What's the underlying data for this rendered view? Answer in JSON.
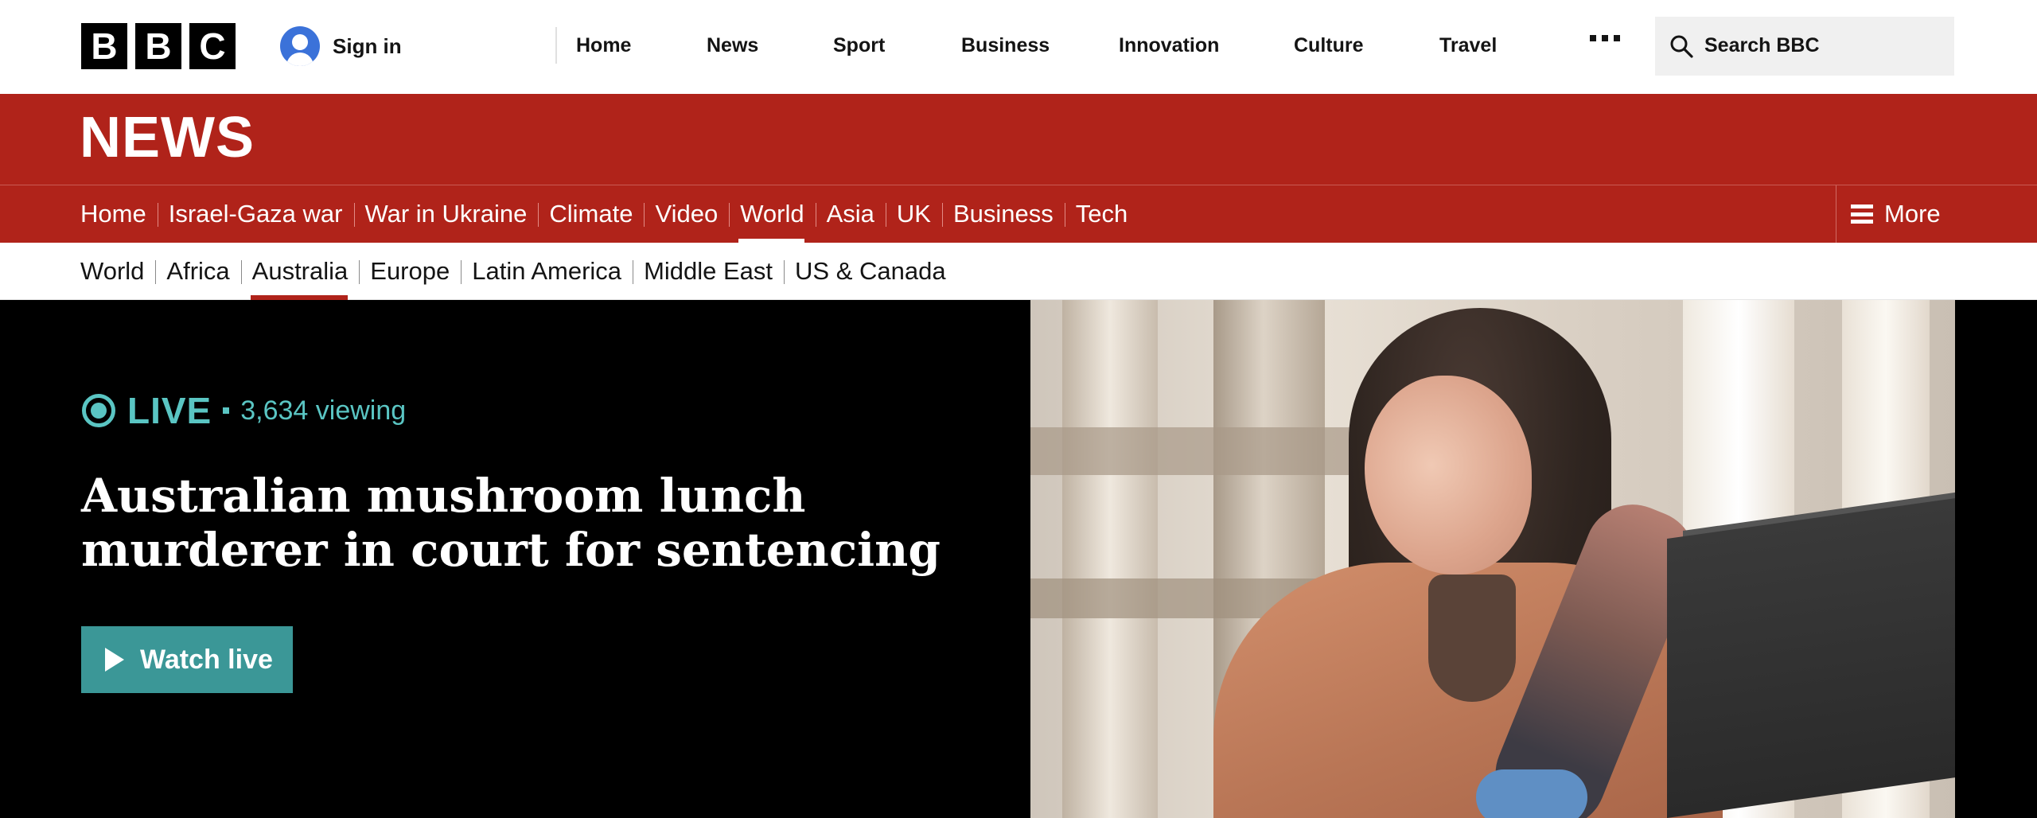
{
  "brand": {
    "logo_letters": [
      "B",
      "B",
      "C"
    ],
    "section_title": "NEWS",
    "colors": {
      "news_red": "#b0231a",
      "live_teal": "#5ac5c3",
      "watch_button": "#3b9797",
      "signin_blue": "#3b72d9"
    }
  },
  "header": {
    "signin_label": "Sign in",
    "signin_icon": "user-avatar-icon",
    "global_nav": [
      "Home",
      "News",
      "Sport",
      "Business",
      "Innovation",
      "Culture",
      "Travel"
    ],
    "more_icon": "more-dots-icon",
    "search_placeholder": "Search BBC",
    "search_icon": "search-icon"
  },
  "section_nav": {
    "items": [
      "Home",
      "Israel-Gaza war",
      "War in Ukraine",
      "Climate",
      "Video",
      "World",
      "Asia",
      "UK",
      "Business",
      "Tech"
    ],
    "active": "World",
    "more_label": "More",
    "more_icon": "hamburger-menu-icon"
  },
  "sub_nav": {
    "items": [
      "World",
      "Africa",
      "Australia",
      "Europe",
      "Latin America",
      "Middle East",
      "US & Canada"
    ],
    "active": "Australia"
  },
  "hero": {
    "live_label": "LIVE",
    "live_icon": "live-broadcast-icon",
    "viewing_count": "3,634 viewing",
    "headline": "Australian mushroom lunch murderer in court for sentencing",
    "watch_label": "Watch live",
    "watch_icon": "play-icon"
  }
}
